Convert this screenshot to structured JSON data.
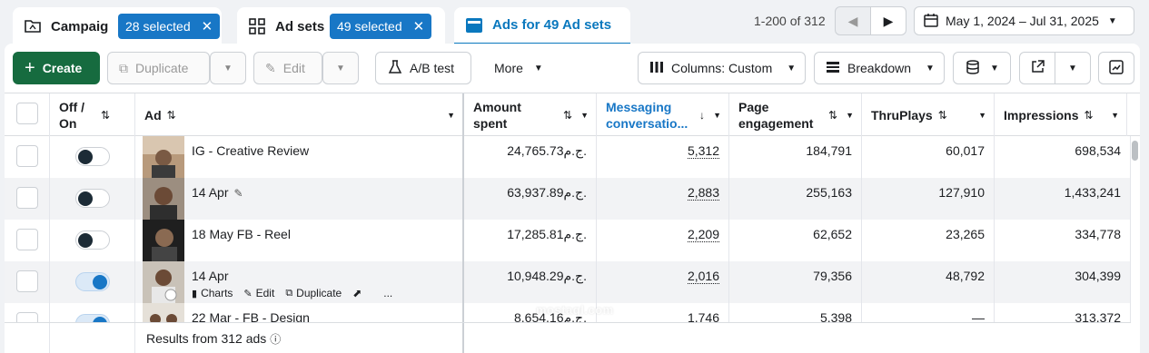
{
  "tabs": {
    "campaigns": {
      "label": "Campaigns",
      "chip": "28 selected"
    },
    "adsets": {
      "label": "Ad sets",
      "chip": "49 selected"
    },
    "ads": {
      "label": "Ads for 49 Ad sets"
    }
  },
  "pager": {
    "range": "1-200 of 312"
  },
  "date_range": "May 1, 2024 – Jul 31, 2025",
  "toolbar": {
    "create": "Create",
    "duplicate": "Duplicate",
    "edit": "Edit",
    "ab_test": "A/B test",
    "more": "More",
    "columns": "Columns: Custom",
    "breakdown": "Breakdown"
  },
  "columns": {
    "off_on": "Off / On",
    "ad": "Ad",
    "amount_spent": "Amount spent",
    "messaging": "Messaging conversatio...",
    "page_engagement": "Page engagement",
    "thruplays": "ThruPlays",
    "impressions": "Impressions"
  },
  "rows": [
    {
      "name": "IG - Creative Review",
      "on": false,
      "amount": "24,765.73ج.م.",
      "messaging": "5,312",
      "engagement": "184,791",
      "thruplays": "60,017",
      "impressions": "698,534"
    },
    {
      "name": "14 Apr",
      "on": false,
      "amount": "63,937.89ج.م.",
      "messaging": "2,883",
      "engagement": "255,163",
      "thruplays": "127,910",
      "impressions": "1,433,241"
    },
    {
      "name": "18 May FB - Reel",
      "on": false,
      "amount": "17,285.81ج.م.",
      "messaging": "2,209",
      "engagement": "62,652",
      "thruplays": "23,265",
      "impressions": "334,778"
    },
    {
      "name": "14 Apr",
      "on": true,
      "amount": "10,948.29ج.م.",
      "messaging": "2,016",
      "engagement": "79,356",
      "thruplays": "48,792",
      "impressions": "304,399"
    },
    {
      "name": "22 Mar - FB - Design",
      "on": true,
      "amount": "8,654.16ج.م.",
      "messaging": "1,746",
      "engagement": "5,398",
      "thruplays": "—",
      "impressions": "313,372"
    }
  ],
  "row_actions": {
    "charts": "Charts",
    "edit": "Edit",
    "duplicate": "Duplicate",
    "more": "..."
  },
  "footer": {
    "results": "Results from 312 ads"
  },
  "watermark": "mostaql.com",
  "colors": {
    "accent": "#1877c6",
    "create": "#166b3f"
  }
}
